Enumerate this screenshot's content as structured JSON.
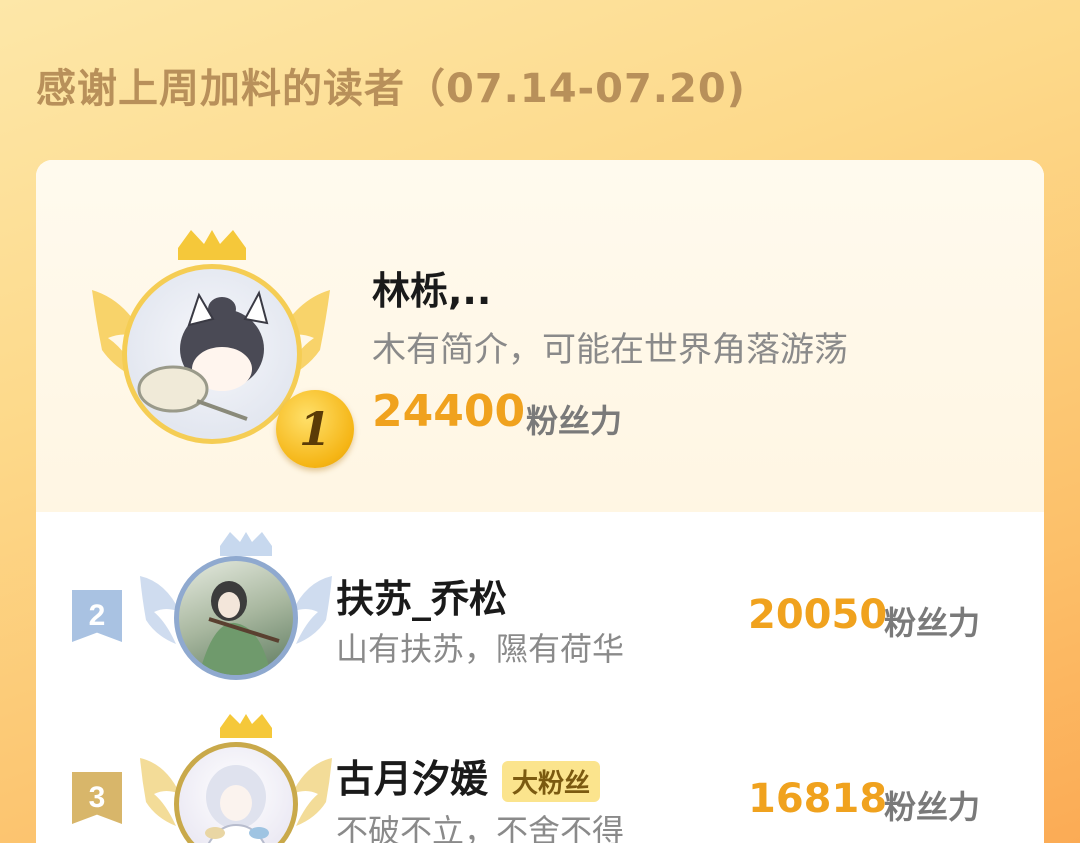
{
  "header": {
    "title": "感谢上周加料的读者（07.14-07.20)"
  },
  "top_reader": {
    "rank": "1",
    "name": "林栎,..",
    "bio": "木有简介，可能在世界角落游荡",
    "score": "24400",
    "score_unit": "粉丝力"
  },
  "readers": [
    {
      "rank": "2",
      "name": "扶苏_乔松",
      "bio": "山有扶苏，隰有荷华",
      "score": "20050",
      "score_unit": "粉丝力",
      "tag": ""
    },
    {
      "rank": "3",
      "name": "古月汐媛",
      "bio": "不破不立，不舍不得",
      "score": "16818",
      "score_unit": "粉丝力",
      "tag": "大粉丝"
    }
  ],
  "colors": {
    "accent": "#f0a21e",
    "gold": "#f5b515",
    "silver": "#9fb8d8",
    "bronze": "#d8b66a"
  }
}
